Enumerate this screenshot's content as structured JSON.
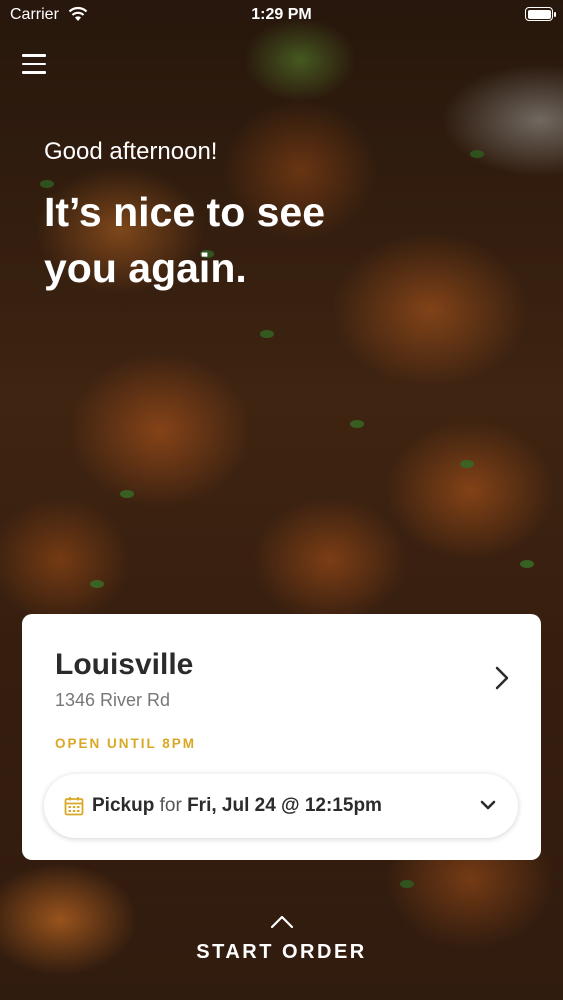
{
  "status_bar": {
    "carrier": "Carrier",
    "time": "1:29 PM",
    "battery_level": 1.0
  },
  "header": {
    "menu_icon": "hamburger-menu-icon",
    "greeting": "Good afternoon!",
    "headline": "It’s nice to see you again."
  },
  "location_card": {
    "name": "Louisville",
    "address": "1346 River Rd",
    "status": "OPEN UNTIL 8PM",
    "status_color": "#d9a826",
    "chevron_icon": "chevron-right-icon",
    "order_option": {
      "calendar_icon": "calendar-icon",
      "mode": "Pickup",
      "connector": "for",
      "time": "Fri, Jul 24 @ 12:15pm",
      "dropdown_icon": "chevron-down-icon"
    }
  },
  "footer": {
    "arrow_icon": "chevron-up-icon",
    "start_order": "START ORDER"
  }
}
